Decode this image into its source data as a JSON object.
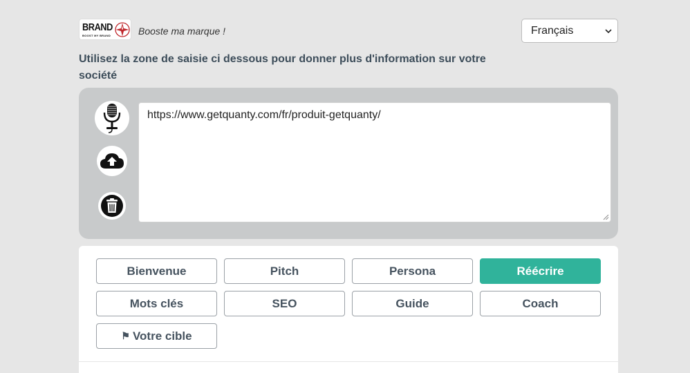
{
  "header": {
    "logo": {
      "text": "BRAND",
      "subtext": "BOOST MY BRAND"
    },
    "tagline": "Booste ma marque !",
    "language": {
      "selected": "Français"
    }
  },
  "instructions": "Utilisez la zone de saisie ci dessous pour donner plus d'information sur votre société",
  "input": {
    "value": "https://www.getquanty.com/fr/produit-getquanty/",
    "icons": [
      "microphone-icon",
      "cloud-upload-icon",
      "trash-icon"
    ]
  },
  "actions": [
    {
      "label": "Bienvenue",
      "active": false
    },
    {
      "label": "Pitch",
      "active": false
    },
    {
      "label": "Persona",
      "active": false
    },
    {
      "label": "Réécrire",
      "active": true
    },
    {
      "label": "Mots clés",
      "active": false
    },
    {
      "label": "SEO",
      "active": false
    },
    {
      "label": "Guide",
      "active": false
    },
    {
      "label": "Coach",
      "active": false
    },
    {
      "label": "Votre cible",
      "active": false,
      "icon": "flag-icon"
    }
  ],
  "colors": {
    "accent": "#30b39b",
    "background": "#e6e6e6",
    "panel": "#c8cacb"
  }
}
